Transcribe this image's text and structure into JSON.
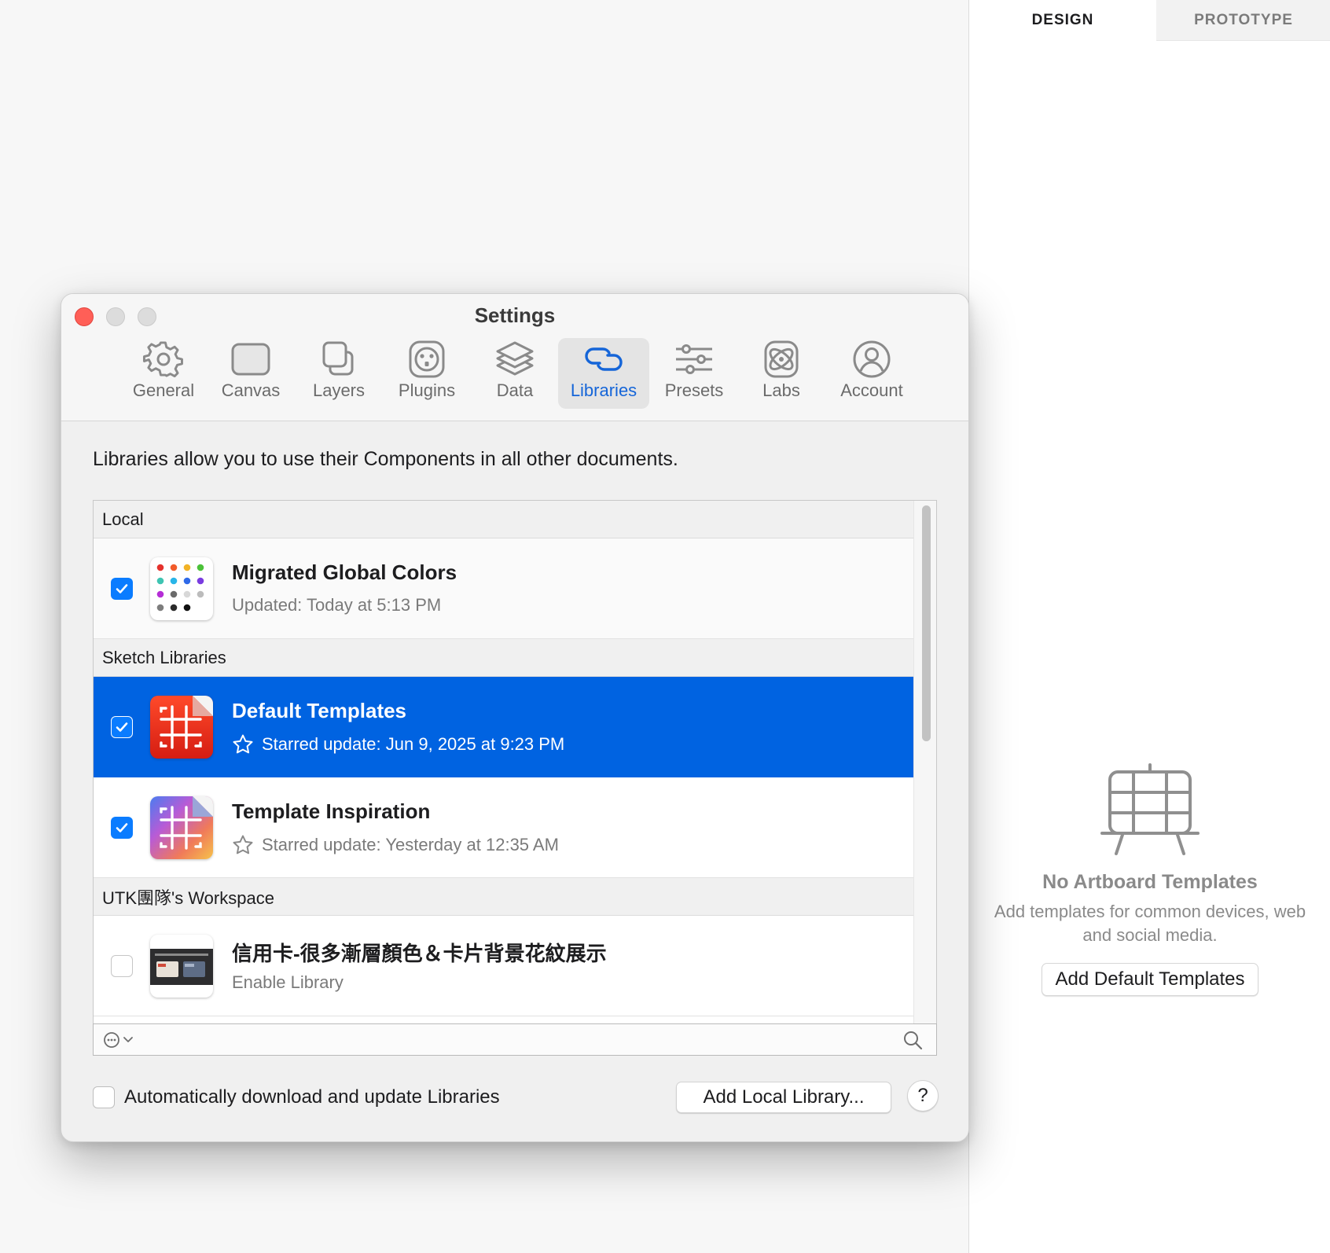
{
  "inspector": {
    "tabs": [
      {
        "label": "DESIGN",
        "active": true
      },
      {
        "label": "PROTOTYPE",
        "active": false
      }
    ],
    "empty_state": {
      "icon": "easel-icon",
      "title": "No Artboard Templates",
      "description": "Add templates for common devices, web and social media.",
      "button_label": "Add Default Templates"
    }
  },
  "settings": {
    "window_title": "Settings",
    "tabs": [
      {
        "label": "General",
        "icon": "gear-icon"
      },
      {
        "label": "Canvas",
        "icon": "canvas-icon"
      },
      {
        "label": "Layers",
        "icon": "layers-icon"
      },
      {
        "label": "Plugins",
        "icon": "plugin-icon"
      },
      {
        "label": "Data",
        "icon": "stack-icon"
      },
      {
        "label": "Libraries",
        "icon": "link-icon",
        "active": true
      },
      {
        "label": "Presets",
        "icon": "sliders-icon"
      },
      {
        "label": "Labs",
        "icon": "atom-icon"
      },
      {
        "label": "Account",
        "icon": "account-icon"
      }
    ],
    "description": "Libraries allow you to use their Components in all other documents.",
    "sections": [
      {
        "header": "Local",
        "items": [
          {
            "name": "Migrated Global Colors",
            "subtitle": "Updated: Today at 5:13 PM",
            "checked": true
          }
        ]
      },
      {
        "header": "Sketch Libraries",
        "items": [
          {
            "name": "Default Templates",
            "subtitle": "Starred update: Jun 9, 2025 at 9:23 PM",
            "checked": true,
            "selected": true
          },
          {
            "name": "Template Inspiration",
            "subtitle": "Starred update: Yesterday at 12:35 AM",
            "checked": true
          }
        ]
      },
      {
        "header": "UTK團隊's Workspace",
        "items": [
          {
            "name": "信用卡-很多漸層顏色＆卡片背景花紋展示",
            "subtitle": "Enable Library",
            "checked": false
          }
        ]
      }
    ],
    "auto_update_label": "Automatically download and update Libraries",
    "add_local_label": "Add Local Library...",
    "help_label": "?",
    "colors": {
      "accent": "#0a7cff",
      "selection": "#0063e1",
      "close": "#ff5f57"
    }
  }
}
